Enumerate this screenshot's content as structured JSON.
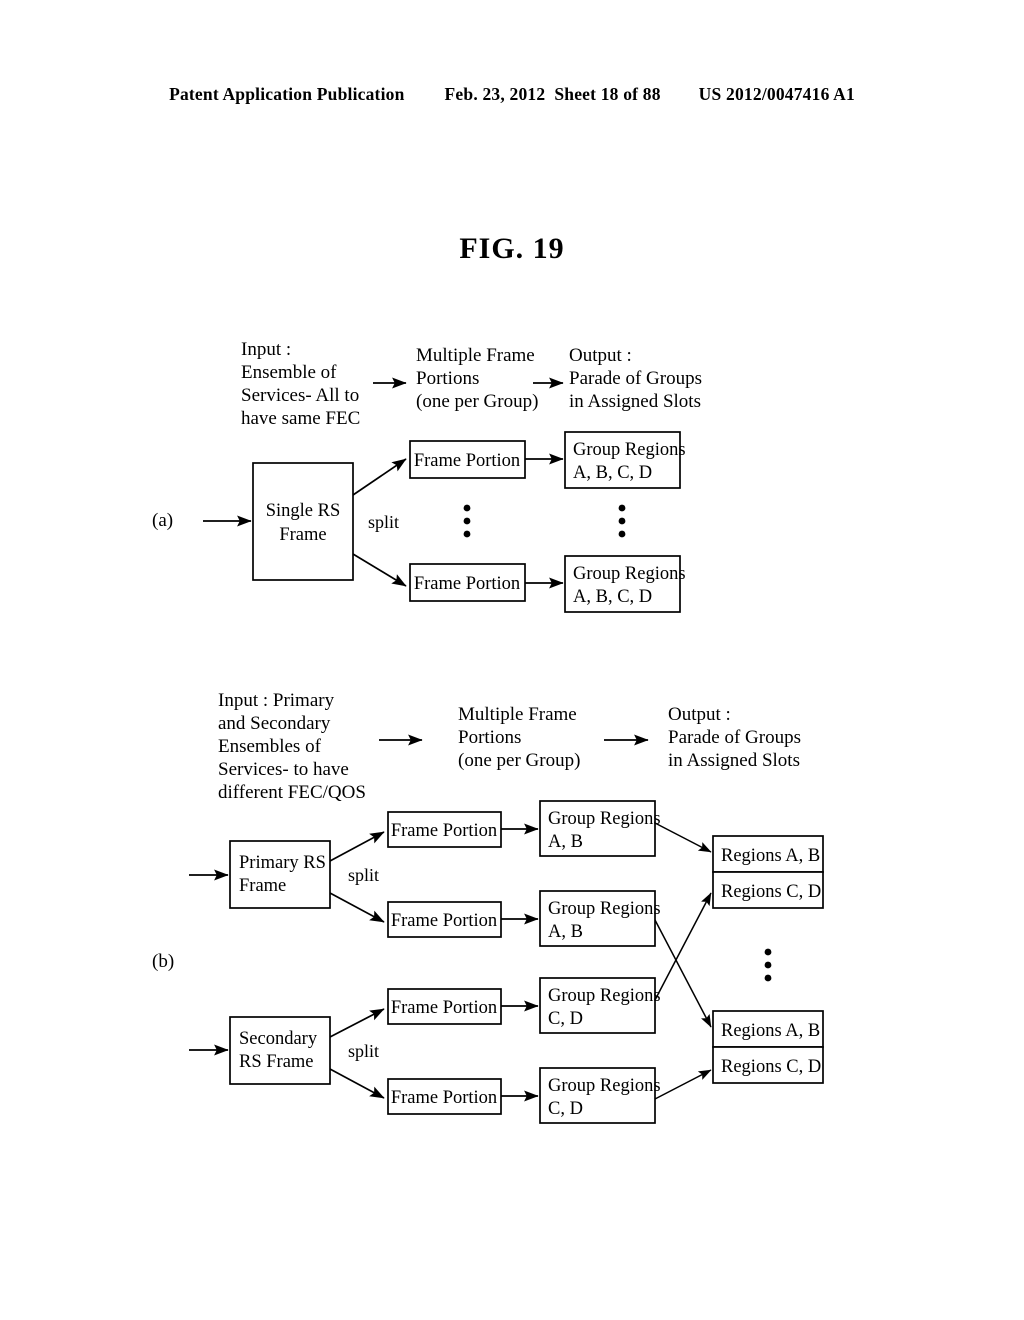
{
  "header": {
    "publication": "Patent Application Publication",
    "date": "Feb. 23, 2012",
    "sheet": "Sheet 18 of 88",
    "patent_number": "US 2012/0047416 A1"
  },
  "figure": {
    "title": "FIG. 19"
  },
  "diagram_a": {
    "label": "(a)",
    "annotations": {
      "input": [
        "Input :",
        "Ensemble of",
        "Services- All to",
        "have same FEC"
      ],
      "middle": [
        "Multiple Frame",
        "Portions",
        "(one per Group)"
      ],
      "output": [
        "Output :",
        "Parade of Groups",
        "in Assigned Slots"
      ]
    },
    "split_label": "split",
    "source_box": [
      "Single RS",
      "Frame"
    ],
    "frame_portions": [
      "Frame Portion",
      "Frame Portion"
    ],
    "group_regions": [
      [
        "Group Regions",
        "A, B, C, D"
      ],
      [
        "Group Regions",
        "A, B, C, D"
      ]
    ],
    "ellipsis": "vertical-ellipsis"
  },
  "diagram_b": {
    "label": "(b)",
    "annotations": {
      "input": [
        "Input : Primary",
        "and Secondary",
        "Ensembles of",
        "Services- to have",
        "different FEC/QOS"
      ],
      "middle": [
        "Multiple Frame",
        "Portions",
        "(one per Group)"
      ],
      "output": [
        "Output :",
        "Parade of Groups",
        "in Assigned Slots"
      ]
    },
    "split_label_primary": "split",
    "split_label_secondary": "split",
    "source_boxes": [
      [
        "Primary RS",
        "Frame"
      ],
      [
        "Secondary",
        "RS Frame"
      ]
    ],
    "frame_portions": [
      "Frame Portion",
      "Frame Portion",
      "Frame Portion",
      "Frame Portion"
    ],
    "group_regions": [
      [
        "Group Regions",
        "A, B"
      ],
      [
        "Group Regions",
        "A, B"
      ],
      [
        "Group Regions",
        "C, D"
      ],
      [
        "Group Regions",
        "C, D"
      ]
    ],
    "output_boxes": [
      {
        "top": "Regions A, B",
        "bottom": "Regions C, D"
      },
      {
        "top": "Regions A, B",
        "bottom": "Regions C, D"
      }
    ],
    "ellipsis": "vertical-ellipsis"
  },
  "colors": {
    "ink": "#000000",
    "paper": "#ffffff"
  }
}
